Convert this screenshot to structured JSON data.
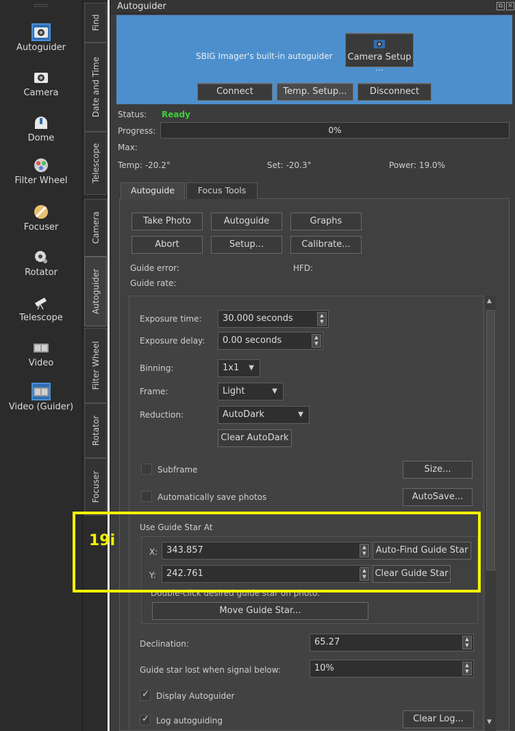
{
  "sidebar": {
    "items": [
      {
        "label": "Autoguider",
        "icon": "camera-icon"
      },
      {
        "label": "Camera",
        "icon": "camera-icon"
      },
      {
        "label": "Dome",
        "icon": "dome-icon"
      },
      {
        "label": "Filter Wheel",
        "icon": "filter-wheel-icon"
      },
      {
        "label": "Focuser",
        "icon": "focuser-icon"
      },
      {
        "label": "Rotator",
        "icon": "rotator-icon"
      },
      {
        "label": "Telescope",
        "icon": "telescope-icon"
      },
      {
        "label": "Video",
        "icon": "video-icon"
      },
      {
        "label": "Video (Guider)",
        "icon": "video-icon"
      }
    ]
  },
  "vtabs": [
    "Find",
    "Date and Time",
    "Telescope",
    "Camera",
    "Autoguider",
    "Filter Wheel",
    "Rotator",
    "Focuser"
  ],
  "window": {
    "title": "Autoguider"
  },
  "header": {
    "driver_text": "SBIG Imager's built-in autoguider",
    "camera_setup": "Camera Setup ...",
    "connect": "Connect",
    "temp_setup": "Temp. Setup...",
    "disconnect": "Disconnect"
  },
  "status": {
    "status_label": "Status:",
    "status_value": "Ready",
    "progress_label": "Progress:",
    "progress_value": "0%",
    "max_label": "Max:",
    "temp": "Temp: -20.2°",
    "set": "Set: -20.3°",
    "power": "Power: 19.0%"
  },
  "tabs": [
    "Autoguide",
    "Focus Tools"
  ],
  "buttons": {
    "take_photo": "Take Photo",
    "autoguide": "Autoguide",
    "graphs": "Graphs",
    "abort": "Abort",
    "setup": "Setup...",
    "calibrate": "Calibrate..."
  },
  "readouts": {
    "guide_error": "Guide error:",
    "hfd": "HFD:",
    "guide_rate": "Guide rate:"
  },
  "settings": {
    "exposure_time_label": "Exposure time:",
    "exposure_time_value": "30.000 seconds",
    "exposure_delay_label": "Exposure delay:",
    "exposure_delay_value": "0.00 seconds",
    "binning_label": "Binning:",
    "binning_value": "1x1",
    "frame_label": "Frame:",
    "frame_value": "Light",
    "reduction_label": "Reduction:",
    "reduction_value": "AutoDark",
    "clear_autodark": "Clear AutoDark",
    "subframe_label": "Subframe",
    "size_button": "Size...",
    "autosave_label": "Automatically save photos",
    "autosave_button": "AutoSave..."
  },
  "guide_star": {
    "group_title": "Use Guide Star At",
    "x_label": "X:",
    "x_value": "343.857",
    "y_label": "Y:",
    "y_value": "242.761",
    "auto_find": "Auto-Find Guide Star",
    "clear": "Clear Guide Star",
    "hint": "Double-click desired guide star on photo.",
    "move": "Move Guide Star..."
  },
  "lower": {
    "declination_label": "Declination:",
    "declination_value": "65.27",
    "lost_label": "Guide star lost when signal below:",
    "lost_value": "10%",
    "display_label": "Display Autoguider",
    "log_label": "Log autoguiding",
    "clear_log": "Clear Log..."
  },
  "annotation": {
    "label": "19i"
  },
  "colors": {
    "accent": "#4d8fcc",
    "annotation": "#f5f500",
    "ready": "#3dd03d"
  }
}
